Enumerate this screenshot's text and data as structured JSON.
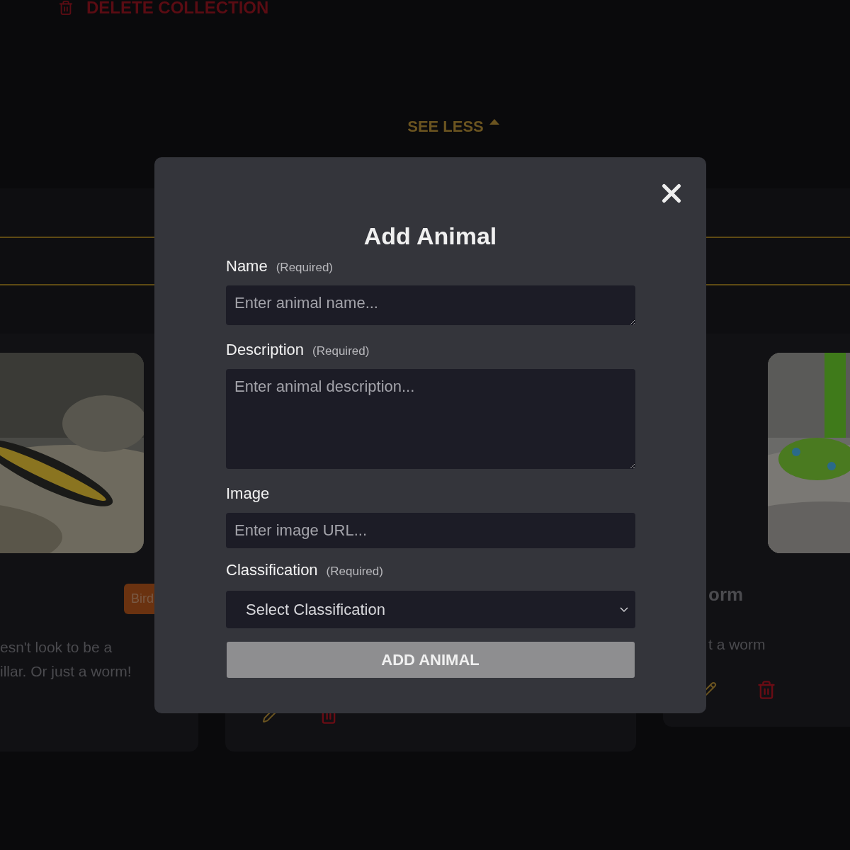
{
  "page": {
    "delete_link": "DELETE COLLECTION",
    "see_less": "SEE LESS",
    "cards": [
      {
        "image": {
          "kind": "picture"
        },
        "tag": "Bird",
        "lines": [
          "esn't look to be a",
          "illar. Or just a worm!"
        ],
        "actions": false
      },
      {
        "actions": true
      },
      {
        "image": {
          "kind": "picture"
        },
        "title": "orm",
        "lines": [
          "t a worm"
        ],
        "actions": true
      }
    ]
  },
  "modal": {
    "title": "Add Animal",
    "fields": [
      {
        "kind": "short-textarea",
        "label": "Name",
        "hint": "(Required)",
        "placeholder": "Enter animal name..."
      },
      {
        "kind": "textarea",
        "label": "Description",
        "hint": "(Required)",
        "placeholder": "Enter animal description..."
      },
      {
        "kind": "input",
        "label": "Image",
        "placeholder": "Enter image URL..."
      },
      {
        "kind": "select",
        "label": "Classification",
        "hint": "(Required)",
        "placeholder": "Select Classification"
      }
    ],
    "submit": "ADD ANIMAL"
  }
}
